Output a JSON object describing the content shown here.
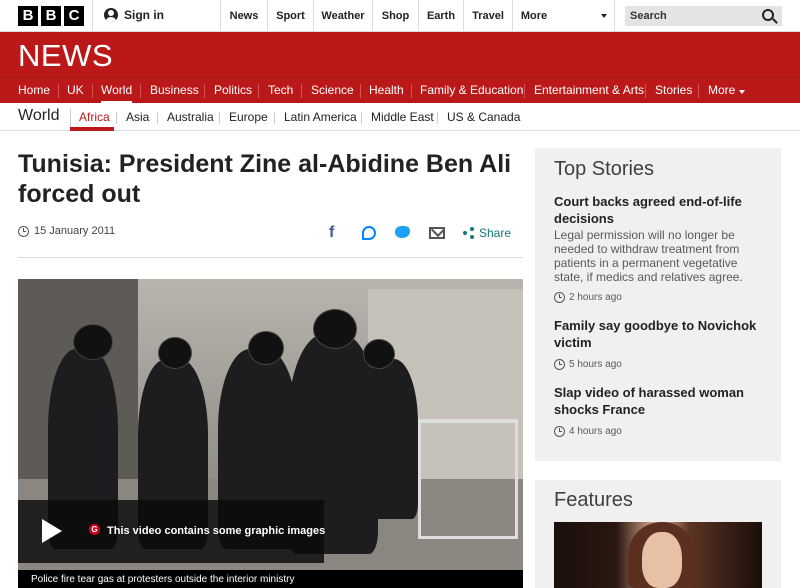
{
  "topbar": {
    "signin": "Sign in",
    "nav": [
      "News",
      "Sport",
      "Weather",
      "Shop",
      "Earth",
      "Travel",
      "More"
    ],
    "search_placeholder": "Search"
  },
  "news_logo": "NEWS",
  "main_nav": {
    "items": [
      "Home",
      "UK",
      "World",
      "Business",
      "Politics",
      "Tech",
      "Science",
      "Health",
      "Family & Education",
      "Entertainment & Arts",
      "Stories",
      "More"
    ],
    "active": "World"
  },
  "sub_nav": {
    "title": "World",
    "items": [
      "Africa",
      "Asia",
      "Australia",
      "Europe",
      "Latin America",
      "Middle East",
      "US & Canada"
    ],
    "active": "Africa"
  },
  "article": {
    "headline": "Tunisia: President Zine al-Abidine Ben Ali forced out",
    "date": "15 January 2011",
    "share_label": "Share",
    "video_warning": "This video contains some graphic images",
    "video_caption": "Police fire tear gas at protesters outside the interior ministry"
  },
  "top_stories": {
    "title": "Top Stories",
    "stories": [
      {
        "title": "Court backs agreed end-of-life decisions",
        "summary": "Legal permission will no longer be needed to withdraw treatment from patients in a permanent vegetative state, if medics and relatives agree.",
        "time": "2 hours ago"
      },
      {
        "title": "Family say goodbye to Novichok victim",
        "time": "5 hours ago"
      },
      {
        "title": "Slap video of harassed woman shocks France",
        "time": "4 hours ago"
      }
    ]
  },
  "features": {
    "title": "Features"
  },
  "colors": {
    "brand_red": "#bb1919",
    "share_teal": "#117b7b"
  }
}
